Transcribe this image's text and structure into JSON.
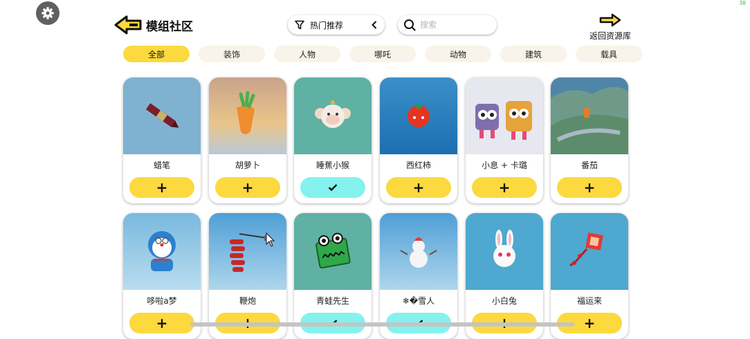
{
  "header": {
    "title": "模组社区",
    "filter_label": "热门推荐",
    "search_placeholder": "搜索",
    "back_label": "返回资源库",
    "fps": "30"
  },
  "categories": [
    {
      "label": "全部",
      "active": true
    },
    {
      "label": "装饰",
      "active": false
    },
    {
      "label": "人物",
      "active": false
    },
    {
      "label": "哪吒",
      "active": false
    },
    {
      "label": "动物",
      "active": false
    },
    {
      "label": "建筑",
      "active": false
    },
    {
      "label": "载具",
      "active": false
    }
  ],
  "items": [
    {
      "name": "蜡笔",
      "added": false,
      "action": "+",
      "art": "crayon"
    },
    {
      "name": "胡萝卜",
      "added": false,
      "action": "+",
      "art": "carrot"
    },
    {
      "name": "睡蕉小猴",
      "added": true,
      "action": "✓",
      "art": "monkey"
    },
    {
      "name": "西红柿",
      "added": false,
      "action": "+",
      "art": "tomato"
    },
    {
      "name": "小息 + 卡璐",
      "added": false,
      "action": "+",
      "art": "robots"
    },
    {
      "name": "番茄",
      "added": false,
      "action": "+",
      "art": "mountain"
    },
    {
      "name": "哆啦a梦",
      "added": false,
      "action": "+",
      "art": "doraemon"
    },
    {
      "name": "鞭炮",
      "added": false,
      "action": "+",
      "art": "firecracker"
    },
    {
      "name": "青蛙先生",
      "added": true,
      "action": "✓",
      "art": "frog"
    },
    {
      "name": "❄�雪人",
      "added": true,
      "action": "✓",
      "art": "snowman"
    },
    {
      "name": "小白兔",
      "added": false,
      "action": "+",
      "art": "rabbit"
    },
    {
      "name": "福运来",
      "added": false,
      "action": "+",
      "art": "fu"
    }
  ],
  "colors": {
    "accent": "#fcd93f",
    "added": "#84f2ef",
    "chip": "#f9f4e9"
  }
}
